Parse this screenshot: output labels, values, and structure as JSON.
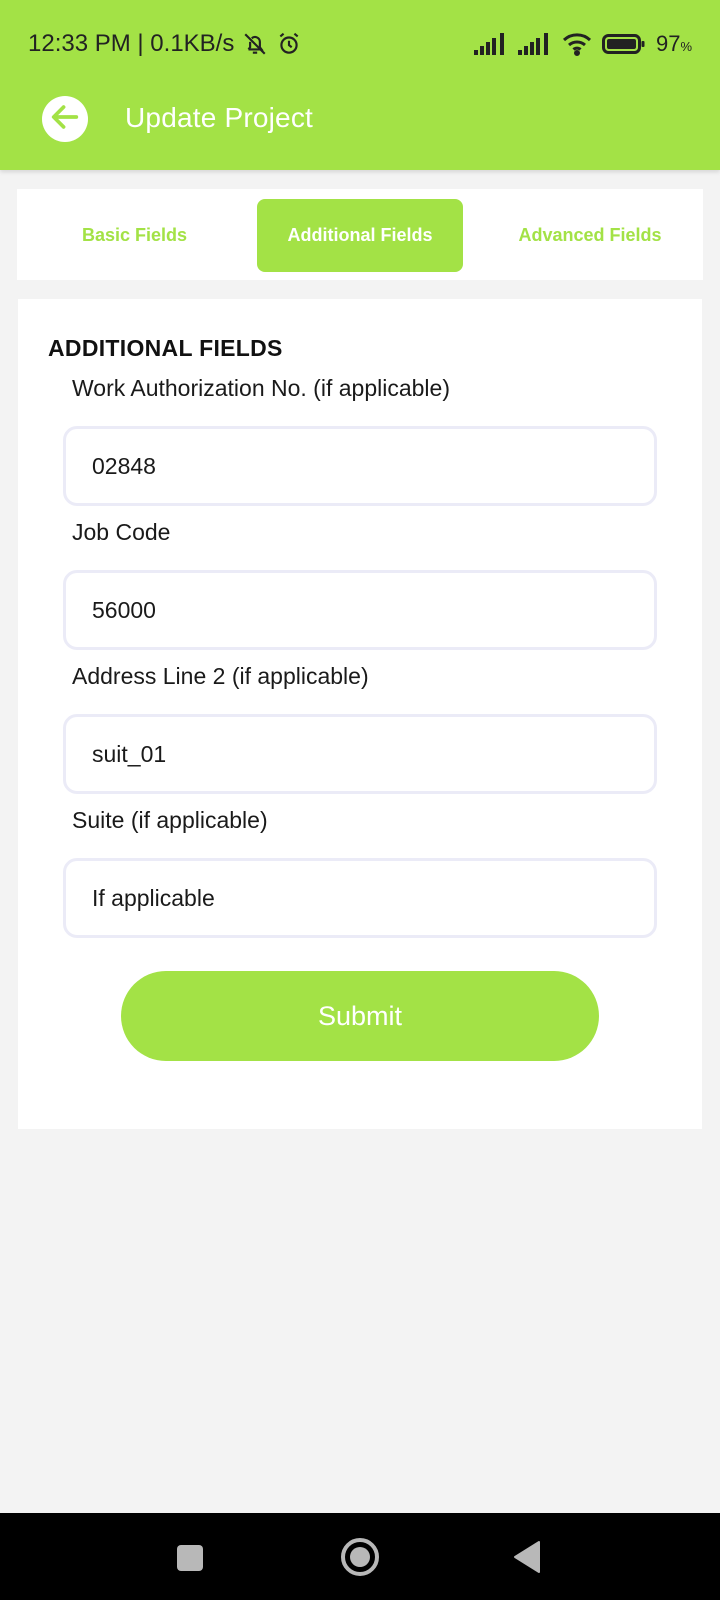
{
  "status_bar": {
    "time_speed": "12:33 PM | 0.1KB/s",
    "battery": "97",
    "battery_unit": "%"
  },
  "app_bar": {
    "title": "Update Project"
  },
  "tabs": [
    {
      "label": "Basic Fields",
      "active": false
    },
    {
      "label": "Additional Fields",
      "active": true
    },
    {
      "label": "Advanced Fields",
      "active": false
    }
  ],
  "form": {
    "section_title": "ADDITIONAL FIELDS",
    "fields": [
      {
        "label": "Work Authorization No. (if applicable)",
        "value": "02848",
        "placeholder": ""
      },
      {
        "label": "Job Code",
        "value": "56000",
        "placeholder": ""
      },
      {
        "label": "Address Line 2 (if applicable)",
        "value": "suit_01",
        "placeholder": ""
      },
      {
        "label": "Suite (if applicable)",
        "value": "",
        "placeholder": "If applicable"
      }
    ],
    "submit_label": "Submit"
  },
  "colors": {
    "accent": "#a3e246",
    "background": "#f3f3f3",
    "input_border": "#ebebf7"
  },
  "icons": {
    "status_left": [
      "bell-off-icon",
      "alarm-icon"
    ],
    "status_right": [
      "signal-icon",
      "signal-icon",
      "wifi-icon",
      "battery-icon"
    ],
    "app_bar": "back-arrow-icon",
    "nav": [
      "recents-icon",
      "home-icon",
      "back-icon"
    ]
  }
}
